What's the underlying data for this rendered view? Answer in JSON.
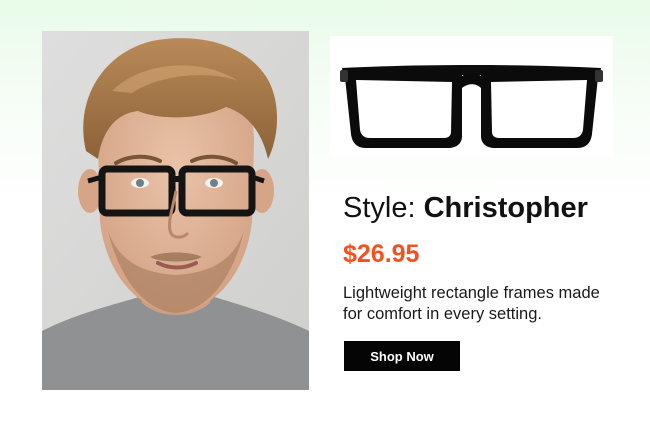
{
  "product": {
    "style_label": "Style:",
    "style_name": "Christopher",
    "price": "$26.95",
    "description": "Lightweight rectangle frames made for comfort in every setting.",
    "cta_label": "Shop Now"
  },
  "colors": {
    "price": "#f4511e",
    "button_bg": "#050505",
    "button_text": "#ffffff",
    "frame": "#111111",
    "header_tint": "#e9fbe9"
  }
}
